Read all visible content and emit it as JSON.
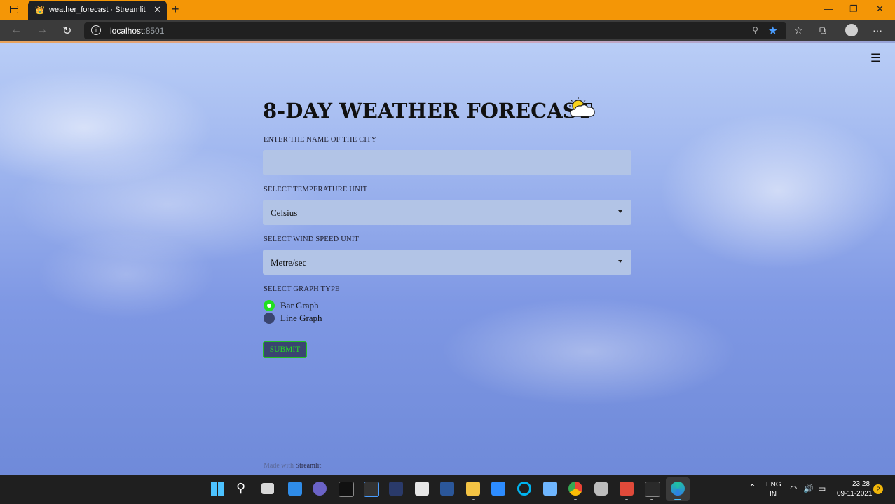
{
  "browser": {
    "tab_title": "weather_forecast · Streamlit",
    "url_host": "localhost",
    "url_port": ":8501"
  },
  "app": {
    "title": "8-DAY WEATHER FORECAST",
    "city_label": "ENTER THE NAME OF THE CITY",
    "city_value": "",
    "temp_label": "SELECT TEMPERATURE UNIT",
    "temp_value": "Celsius",
    "wind_label": "SELECT WIND SPEED UNIT",
    "wind_value": "Metre/sec",
    "graph_label": "SELECT GRAPH TYPE",
    "graph_options": [
      "Bar Graph",
      "Line Graph"
    ],
    "graph_selected": "Bar Graph",
    "submit_label": "SUBMIT",
    "footer_prefix": "Made with",
    "footer_brand": "Streamlit"
  },
  "colors": {
    "radio_selected": "#21e021",
    "submit_text": "#27d827",
    "browser_tabbar": "#f49606"
  },
  "taskbar": {
    "lang_line1": "ENG",
    "lang_line2": "IN",
    "time": "23:28",
    "date": "09-11-2021",
    "notification_count": "2"
  }
}
